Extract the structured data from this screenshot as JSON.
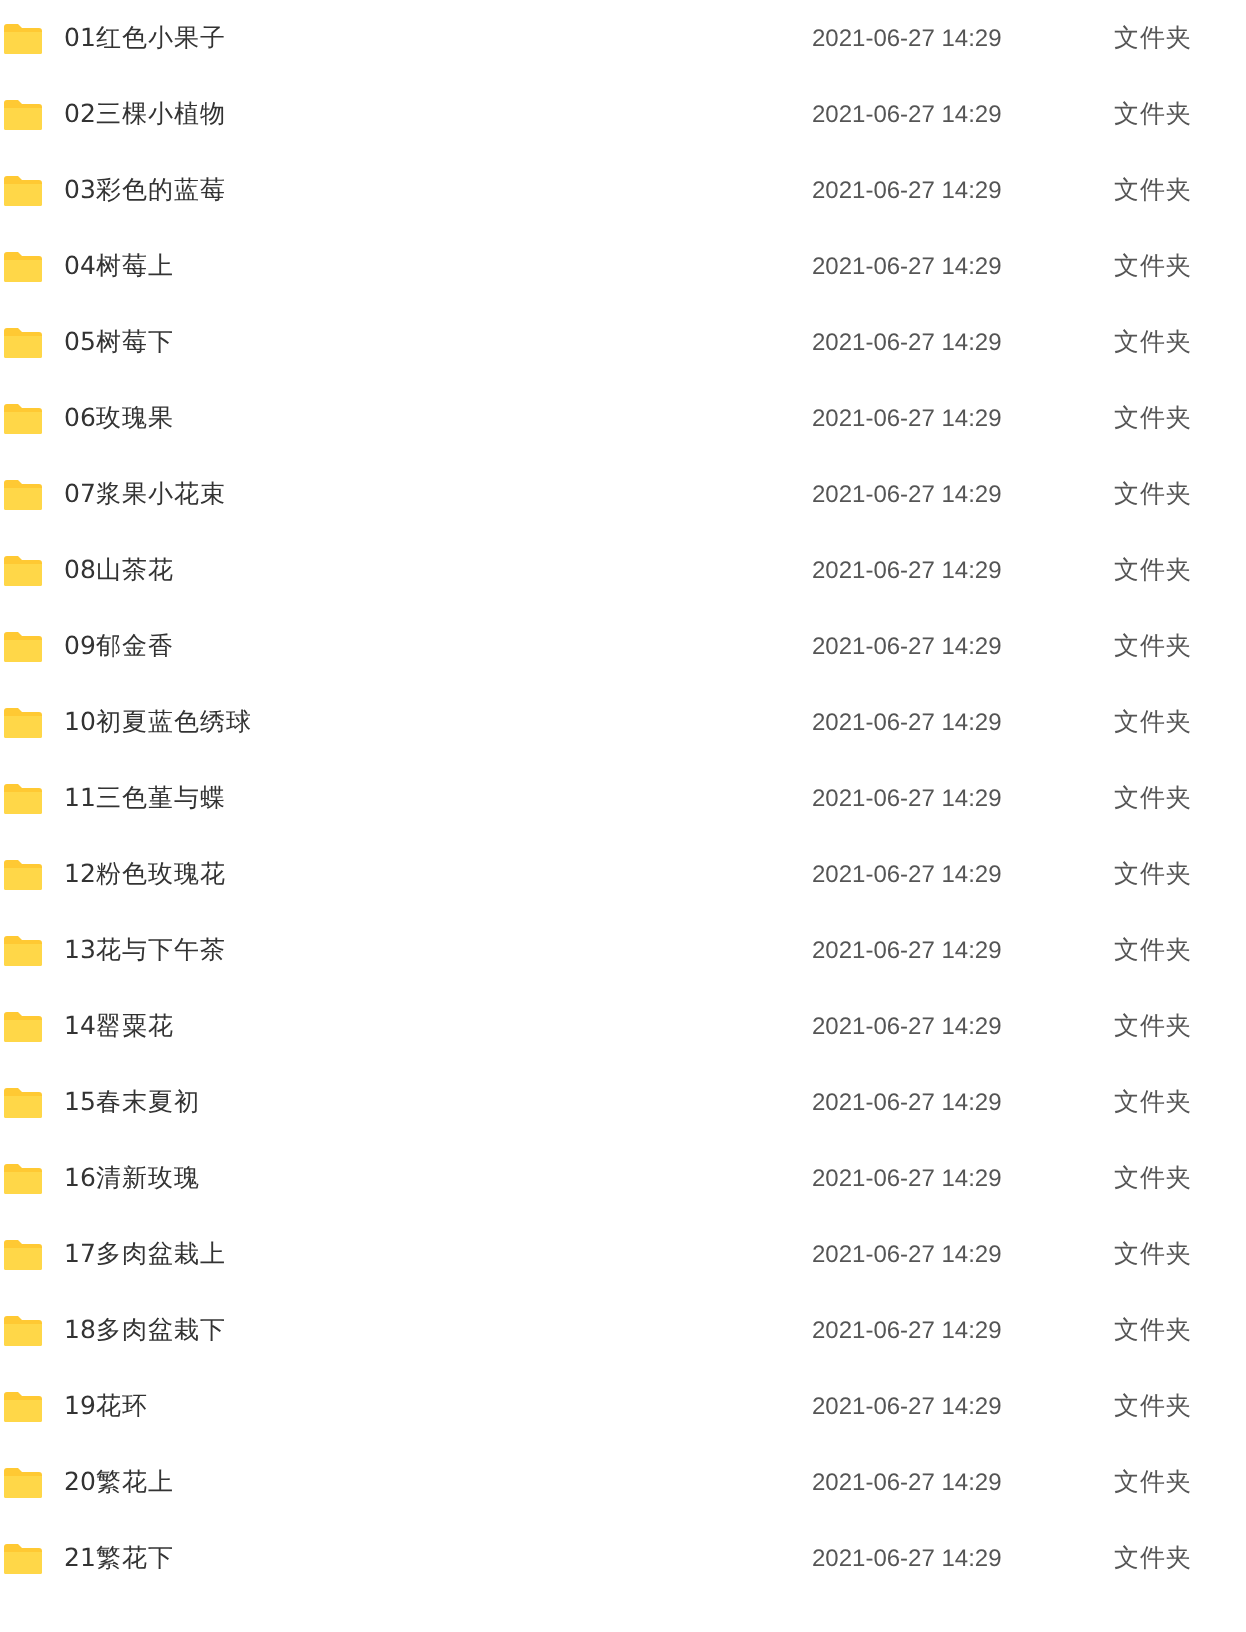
{
  "files": [
    {
      "name": "01红色小果子",
      "modified": "2021-06-27 14:29",
      "type": "文件夹"
    },
    {
      "name": "02三棵小植物",
      "modified": "2021-06-27 14:29",
      "type": "文件夹"
    },
    {
      "name": "03彩色的蓝莓",
      "modified": "2021-06-27 14:29",
      "type": "文件夹"
    },
    {
      "name": "04树莓上",
      "modified": "2021-06-27 14:29",
      "type": "文件夹"
    },
    {
      "name": "05树莓下",
      "modified": "2021-06-27 14:29",
      "type": "文件夹"
    },
    {
      "name": "06玫瑰果",
      "modified": "2021-06-27 14:29",
      "type": "文件夹"
    },
    {
      "name": "07浆果小花束",
      "modified": "2021-06-27 14:29",
      "type": "文件夹"
    },
    {
      "name": "08山茶花",
      "modified": "2021-06-27 14:29",
      "type": "文件夹"
    },
    {
      "name": "09郁金香",
      "modified": "2021-06-27 14:29",
      "type": "文件夹"
    },
    {
      "name": "10初夏蓝色绣球",
      "modified": "2021-06-27 14:29",
      "type": "文件夹"
    },
    {
      "name": "11三色堇与蝶",
      "modified": "2021-06-27 14:29",
      "type": "文件夹"
    },
    {
      "name": "12粉色玫瑰花",
      "modified": "2021-06-27 14:29",
      "type": "文件夹"
    },
    {
      "name": "13花与下午茶",
      "modified": "2021-06-27 14:29",
      "type": "文件夹"
    },
    {
      "name": "14罂粟花",
      "modified": "2021-06-27 14:29",
      "type": "文件夹"
    },
    {
      "name": "15春末夏初",
      "modified": "2021-06-27 14:29",
      "type": "文件夹"
    },
    {
      "name": "16清新玫瑰",
      "modified": "2021-06-27 14:29",
      "type": "文件夹"
    },
    {
      "name": "17多肉盆栽上",
      "modified": "2021-06-27 14:29",
      "type": "文件夹"
    },
    {
      "name": "18多肉盆栽下",
      "modified": "2021-06-27 14:29",
      "type": "文件夹"
    },
    {
      "name": "19花环",
      "modified": "2021-06-27 14:29",
      "type": "文件夹"
    },
    {
      "name": "20繁花上",
      "modified": "2021-06-27 14:29",
      "type": "文件夹"
    },
    {
      "name": "21繁花下",
      "modified": "2021-06-27 14:29",
      "type": "文件夹"
    }
  ]
}
